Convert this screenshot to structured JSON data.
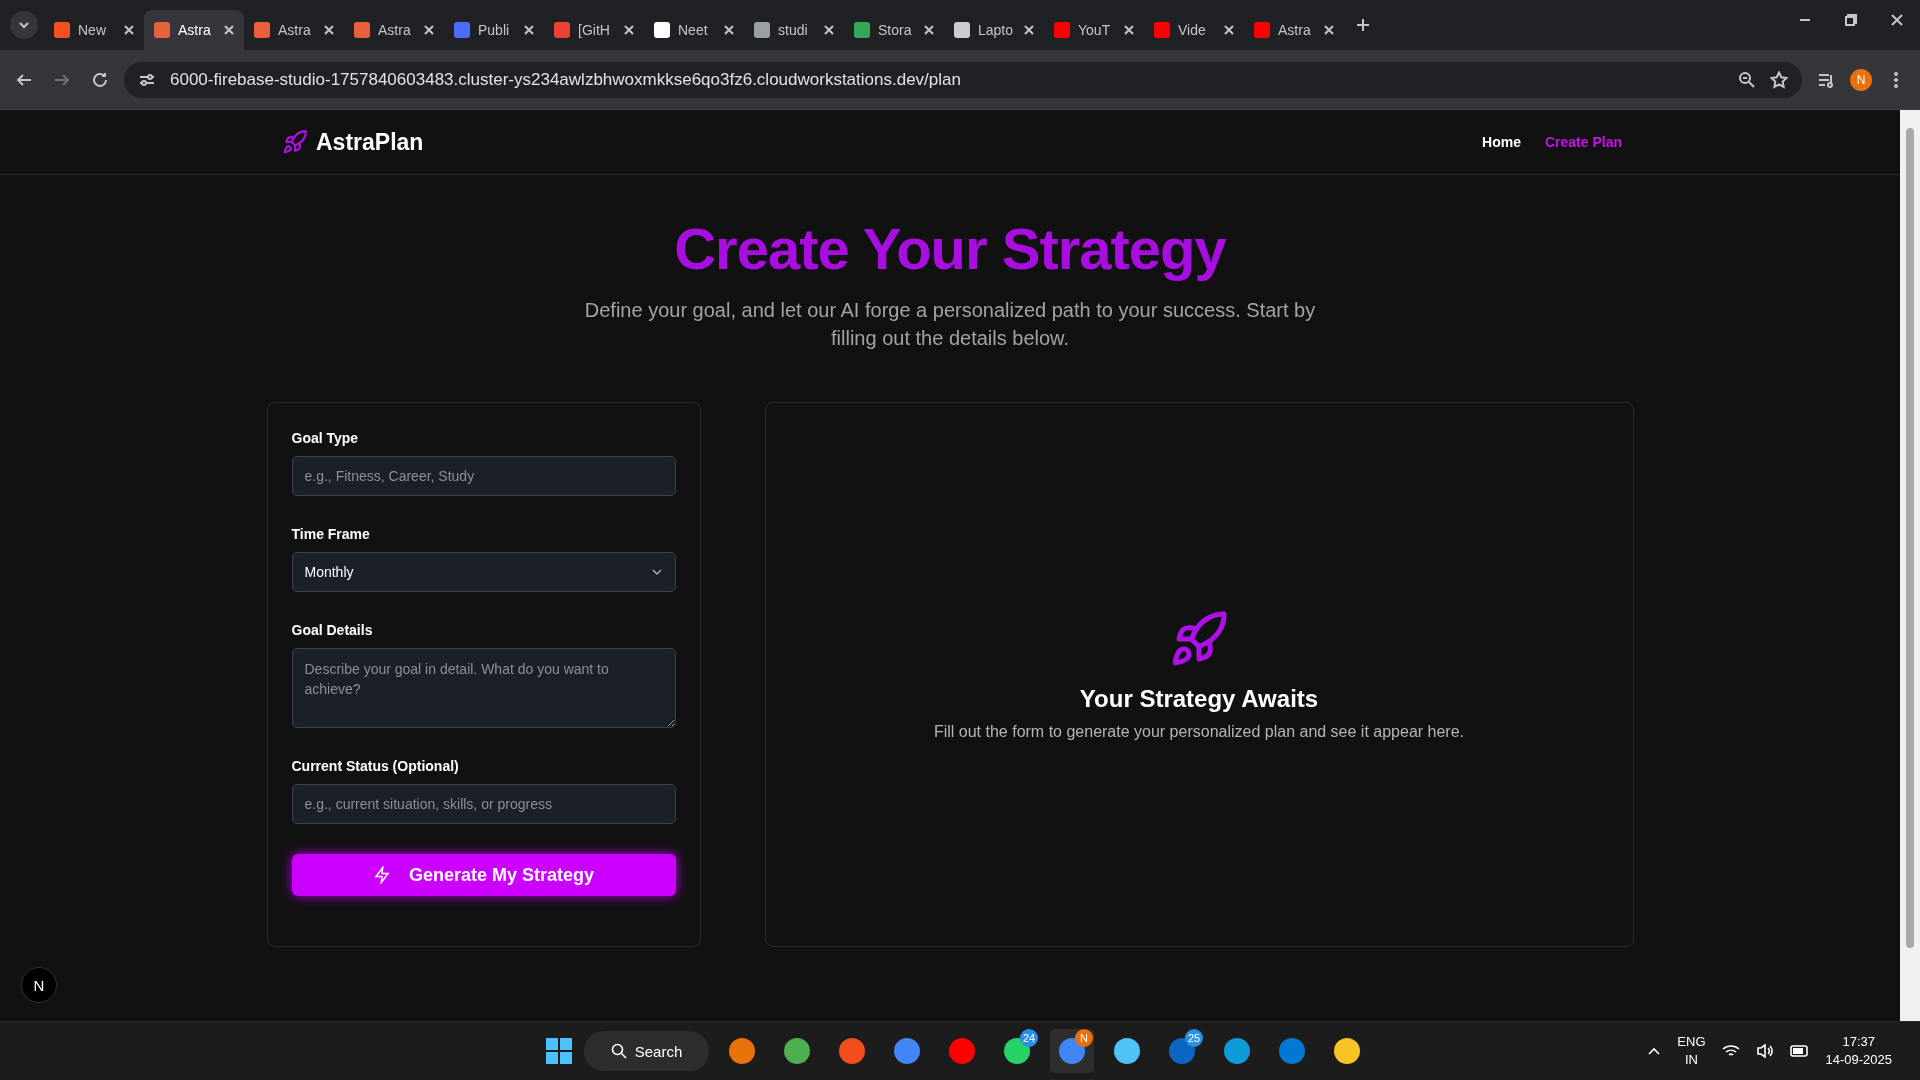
{
  "browser": {
    "tabs": [
      {
        "label": "New",
        "selected": false
      },
      {
        "label": "Astra",
        "selected": true
      },
      {
        "label": "Astra",
        "selected": false
      },
      {
        "label": "Astra",
        "selected": false
      },
      {
        "label": "Publi",
        "selected": false
      },
      {
        "label": "[GitH",
        "selected": false
      },
      {
        "label": "Neet",
        "selected": false
      },
      {
        "label": "studi",
        "selected": false
      },
      {
        "label": "Stora",
        "selected": false
      },
      {
        "label": "Lapto",
        "selected": false
      },
      {
        "label": "YouT",
        "selected": false
      },
      {
        "label": "Vide",
        "selected": false
      },
      {
        "label": "Astra",
        "selected": false
      }
    ],
    "url": "6000-firebase-studio-1757840603483.cluster-ys234awlzbhwoxmkkse6qo3fz6.cloudworkstations.dev/plan",
    "profile": "N"
  },
  "header": {
    "brand": "AstraPlan",
    "nav": [
      {
        "label": "Home",
        "selected": false
      },
      {
        "label": "Create Plan",
        "selected": true
      }
    ]
  },
  "hero": {
    "title": "Create Your Strategy",
    "subtitle": "Define your goal, and let our AI forge a personalized path to your success. Start by filling out the details below."
  },
  "form": {
    "fields": [
      {
        "kind": "input",
        "label": "Goal Type",
        "placeholder": "e.g., Fitness, Career, Study"
      },
      {
        "kind": "select",
        "label": "Time Frame",
        "value": "Monthly"
      },
      {
        "kind": "textarea",
        "label": "Goal Details",
        "placeholder": "Describe your goal in detail. What do you want to achieve?"
      },
      {
        "kind": "input",
        "label": "Current Status (Optional)",
        "placeholder": "e.g., current situation, skills, or progress"
      }
    ],
    "submit": "Generate My Strategy"
  },
  "result": {
    "title": "Your Strategy Awaits",
    "text": "Fill out the form to generate your personalized plan and see it appear here."
  },
  "dev_badge": "N",
  "taskbar": {
    "search": "Search",
    "badges": [
      "24",
      "N",
      "25"
    ],
    "language": "ENG",
    "region": "IN",
    "time": "17:37",
    "date": "14-09-2025"
  }
}
